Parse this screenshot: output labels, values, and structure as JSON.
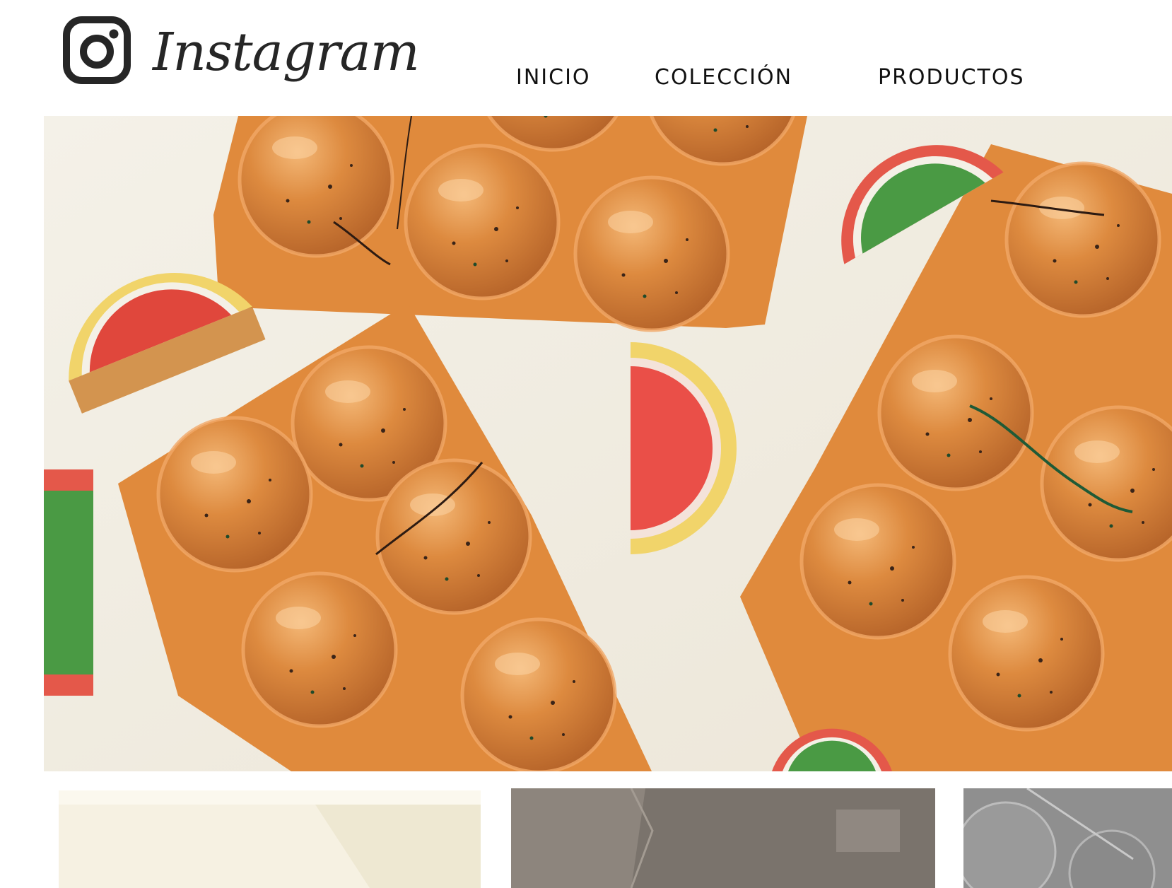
{
  "brand": {
    "wordmark": "Instagram",
    "icon": "instagram-icon"
  },
  "nav": {
    "items": [
      {
        "label": "INICIO"
      },
      {
        "label": "COLECCIÓN"
      },
      {
        "label": "PRODUCTOS"
      }
    ]
  },
  "hero": {
    "subject": "orange chocolate bars with jelly fruit slices"
  },
  "thumbnails": [
    {
      "name": "white-chocolate"
    },
    {
      "name": "dark-chocolate"
    },
    {
      "name": "textured-chocolate"
    }
  ],
  "colors": {
    "background": "#ffffff",
    "text": "#111111",
    "bar_orange": "#e08a3c",
    "jelly_red": "#e0473c",
    "jelly_green": "#4a9a44",
    "jelly_yellow": "#f1d46a"
  }
}
